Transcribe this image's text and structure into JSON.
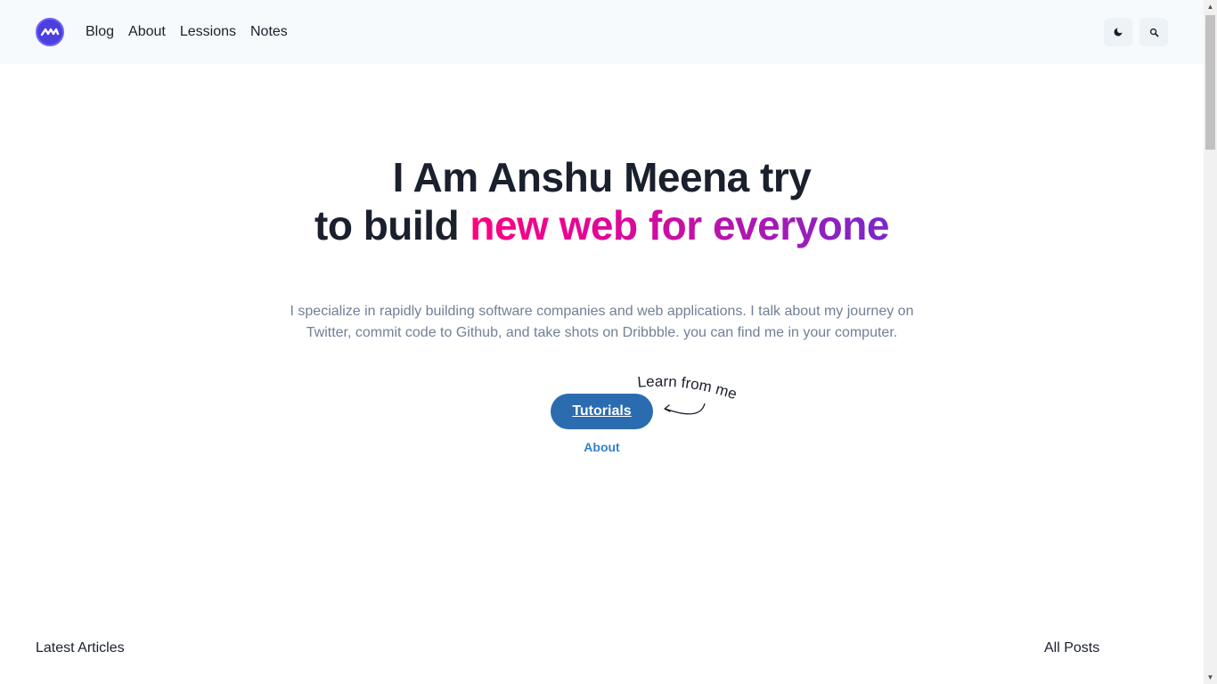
{
  "header": {
    "nav": [
      "Blog",
      "About",
      "Lessions",
      "Notes"
    ],
    "theme_toggle_icon": "moon-icon",
    "search_icon": "search-icon",
    "logo_icon": "brand-logo-icon"
  },
  "hero": {
    "title_line1": "I Am Anshu Meena try",
    "title_line2_prefix": "to build ",
    "title_line2_highlight": "new web for everyone",
    "description": "I specialize in rapidly building software companies and web applications. I talk about my journey on Twitter, commit code to Github, and take shots on Dribbble. you can find me in your computer.",
    "primary_button": "Tutorials",
    "callout": "Learn from me",
    "secondary_link": "About"
  },
  "latest": {
    "title": "Latest Articles",
    "all_posts": "All Posts"
  },
  "colors": {
    "primary": "#2b6cb0",
    "link": "#3182ce",
    "gradient_start": "#ff0080",
    "gradient_end": "#7928ca",
    "logo": "#4c3fe0"
  }
}
